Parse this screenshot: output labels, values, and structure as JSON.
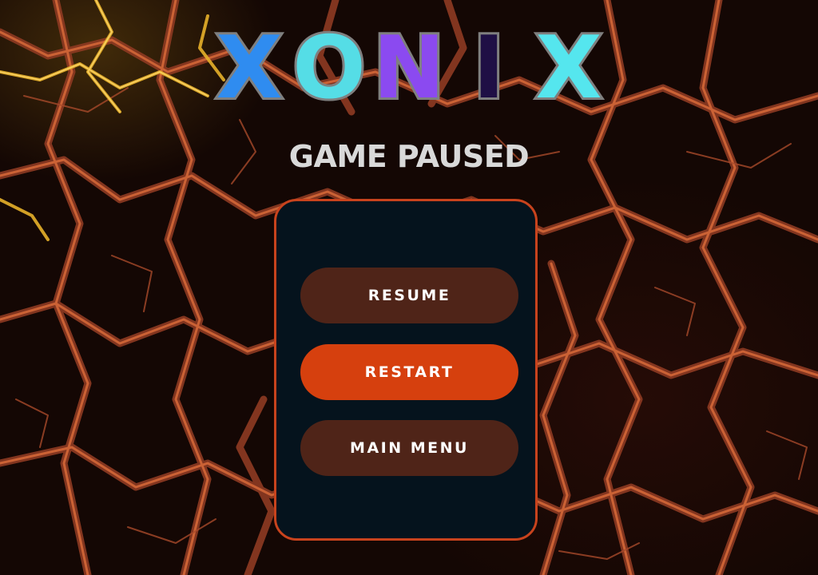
{
  "game": {
    "logo": {
      "letters": [
        "X",
        "O",
        "N",
        "I",
        "X"
      ],
      "letter_colors": [
        "#2f8cf0",
        "#55dde6",
        "#8b4af0",
        "#1f0f45",
        "#55e6ee"
      ],
      "outline_color": "#7f7f7f"
    },
    "pause_title": "GAME PAUSED"
  },
  "menu": {
    "resume_label": "RESUME",
    "restart_label": "RESTART",
    "main_menu_label": "MAIN MENU"
  },
  "colors": {
    "panel_bg": "#05131d",
    "panel_border": "#c8431d",
    "button_dark": "#4f2418",
    "button_accent": "#d6400e",
    "title_text": "#d9d9d9",
    "button_text": "#ffffff"
  },
  "background": {
    "icon": "lava-cracks-texture"
  }
}
